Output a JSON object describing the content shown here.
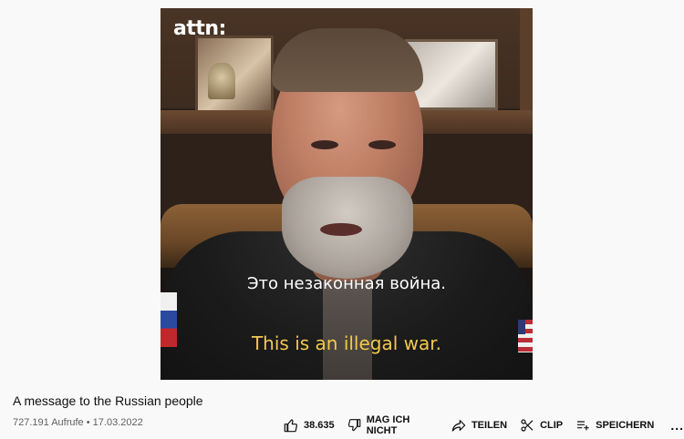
{
  "video": {
    "logo": "attn:",
    "subtitle_ru": "Это незаконная война.",
    "subtitle_en": "This is an illegal war."
  },
  "title": "A message to the Russian people",
  "meta": {
    "views": "727.191 Aufrufe",
    "separator": "•",
    "date": "17.03.2022"
  },
  "actions": {
    "like_count": "38.635",
    "dislike_label": "MAG ICH NICHT",
    "share_label": "TEILEN",
    "clip_label": "CLIP",
    "save_label": "SPEICHERN",
    "more_label": "..."
  },
  "icons": [
    "thumbs-up-icon",
    "thumbs-down-icon",
    "share-icon",
    "scissors-icon",
    "playlist-add-icon"
  ]
}
